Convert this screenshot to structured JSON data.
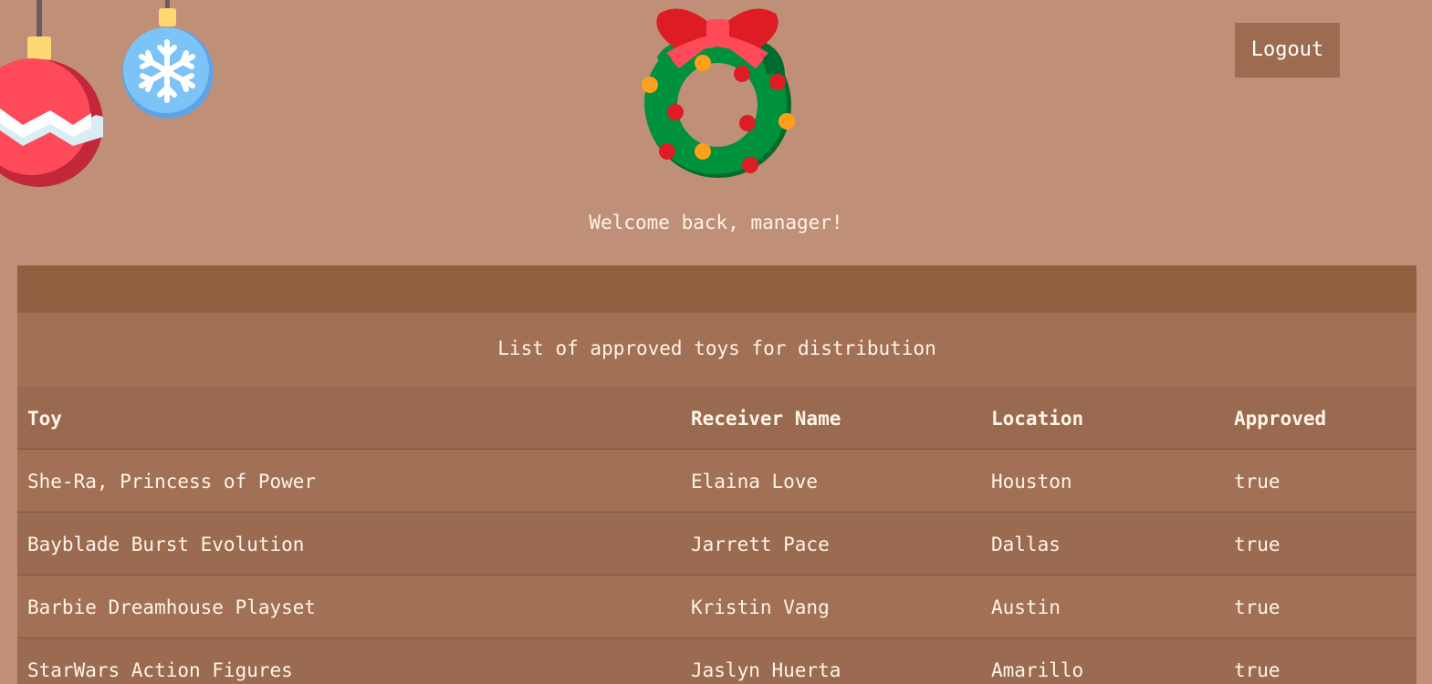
{
  "header": {
    "logout_label": "Logout",
    "welcome_text": "Welcome back, manager!"
  },
  "table": {
    "caption": "List of approved toys for distribution",
    "columns": [
      "Toy",
      "Receiver Name",
      "Location",
      "Approved"
    ],
    "rows": [
      [
        "She-Ra, Princess of Power",
        "Elaina Love",
        "Houston",
        "true"
      ],
      [
        "Bayblade Burst Evolution",
        "Jarrett Pace",
        "Dallas",
        "true"
      ],
      [
        "Barbie Dreamhouse Playset",
        "Kristin Vang",
        "Austin",
        "true"
      ],
      [
        "StarWars Action Figures",
        "Jaslyn Huerta",
        "Amarillo",
        "true"
      ]
    ]
  },
  "decorations": {
    "ornaments": [
      "red-ornament-icon",
      "blue-snowflake-ornament-icon"
    ],
    "centerpiece": "christmas-wreath-icon"
  },
  "colors": {
    "background": "#bf9077",
    "table_topbar": "#925f41",
    "logout_button": "#9d6b50"
  }
}
